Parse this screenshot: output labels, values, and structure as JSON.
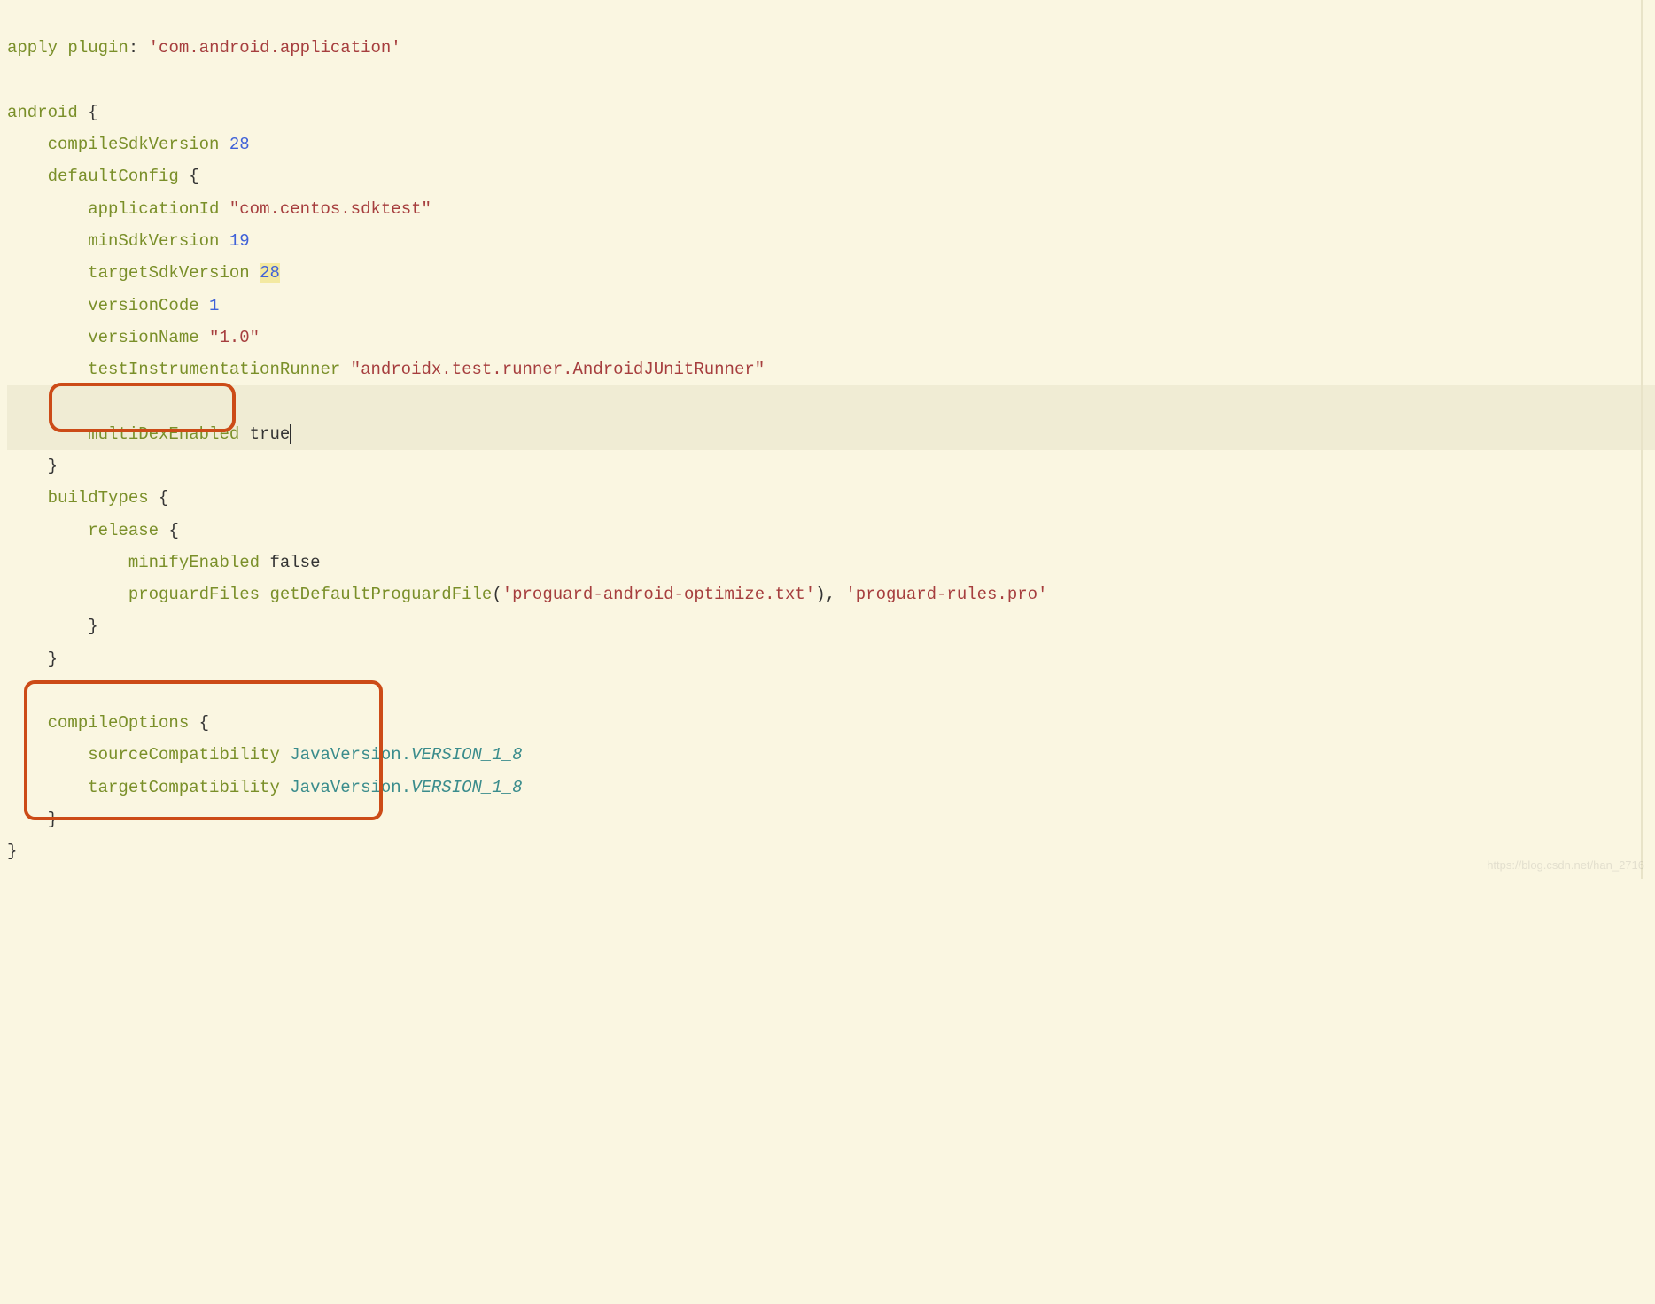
{
  "line1": {
    "apply": "apply",
    "plugin": "plugin",
    "colon": ": ",
    "val": "'com.android.application'"
  },
  "line3": {
    "android": "android",
    "brace": " {"
  },
  "line4": {
    "name": "compileSdkVersion ",
    "num": "28"
  },
  "line5": {
    "name": "defaultConfig ",
    "brace": "{"
  },
  "line6": {
    "name": "applicationId ",
    "val": "\"com.centos.sdktest\""
  },
  "line7": {
    "name": "minSdkVersion ",
    "num": "19"
  },
  "line8": {
    "name": "targetSdkVersion ",
    "num": "28"
  },
  "line9": {
    "name": "versionCode ",
    "num": "1"
  },
  "line10": {
    "name": "versionName ",
    "val": "\"1.0\""
  },
  "line11": {
    "name": "testInstrumentationRunner ",
    "val": "\"androidx.test.runner.AndroidJUnitRunner\""
  },
  "line13": {
    "name": "multiDexEnabled ",
    "kw": "true"
  },
  "line14": "}",
  "line15": {
    "name": "buildTypes ",
    "brace": "{"
  },
  "line16": {
    "name": "release ",
    "brace": "{"
  },
  "line17": {
    "name": "minifyEnabled ",
    "kw": "false"
  },
  "line18": {
    "name": "proguardFiles ",
    "fn": "getDefaultProguardFile",
    "p1": "(",
    "s1": "'proguard-android-optimize.txt'",
    "p2": ")",
    "c": ", ",
    "s2": "'proguard-rules.pro'"
  },
  "line19": "}",
  "line20": "}",
  "line22": {
    "name": "compileOptions ",
    "brace": "{"
  },
  "line23": {
    "name": "sourceCompatibility ",
    "cls": "JavaVersion",
    "dot": ".",
    "mem": "VERSION_1_8"
  },
  "line24": {
    "name": "targetCompatibility ",
    "cls": "JavaVersion",
    "dot": ".",
    "mem": "VERSION_1_8"
  },
  "line25": "}",
  "line26": "}",
  "watermark": "https://blog.csdn.net/han_2716"
}
